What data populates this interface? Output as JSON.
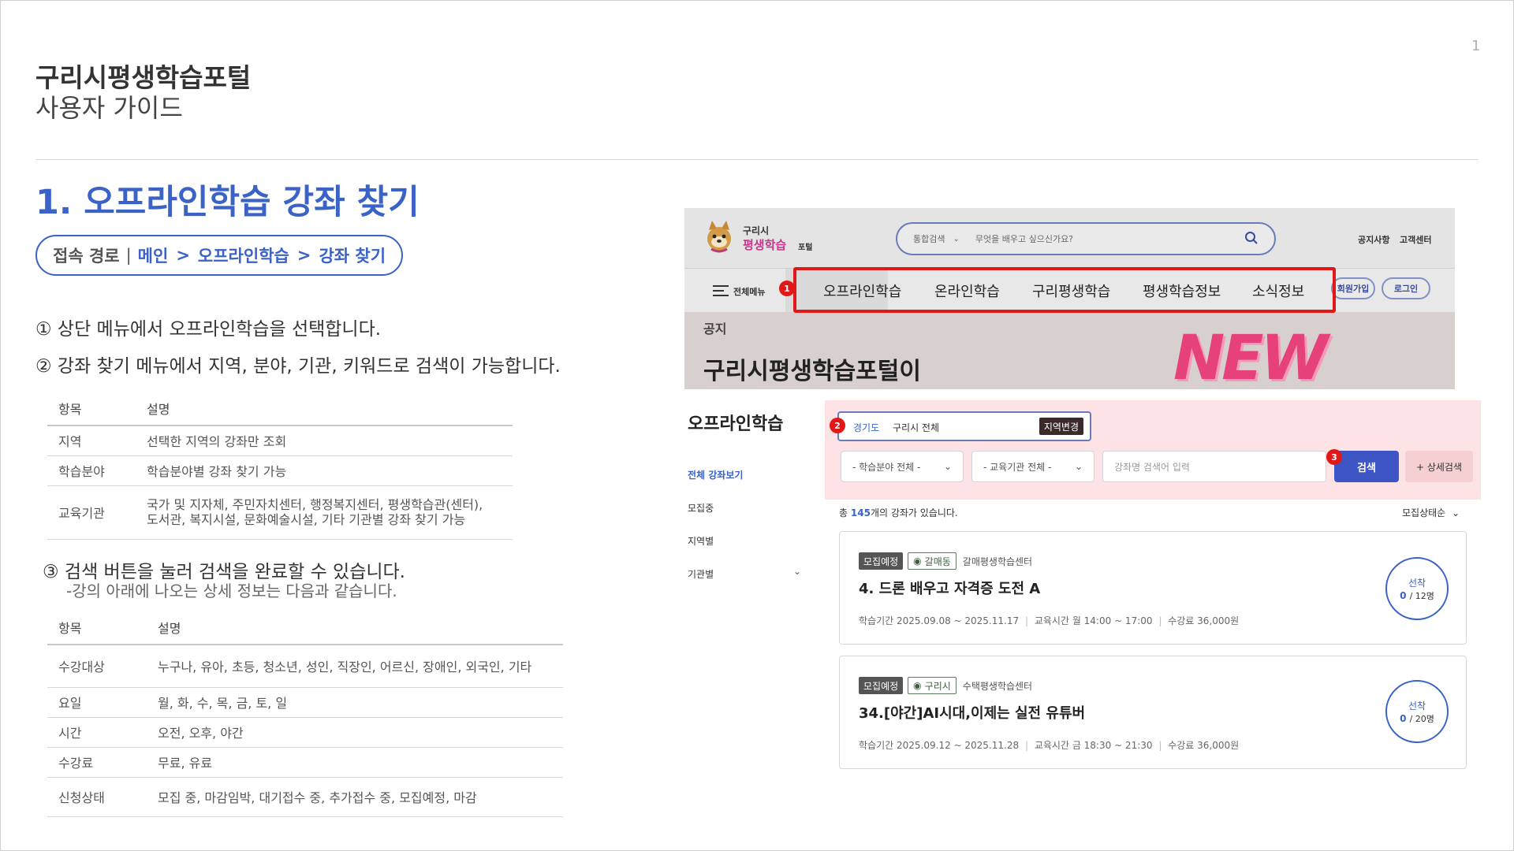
{
  "header": {
    "title": "구리시평생학습포털",
    "subtitle": "사용자 가이드",
    "page_number": "1"
  },
  "section": {
    "title": "1. 오프라인학습 강좌 찾기",
    "path_label": "접속 경로",
    "path_separator": "|",
    "path": [
      "메인",
      "오프라인학습",
      "강좌 찾기"
    ],
    "path_arrow": ">"
  },
  "steps": {
    "step1": "① 상단 메뉴에서 오프라인학습을 선택합니다.",
    "step2": "② 강좌 찾기 메뉴에서 지역, 분야, 기관, 키워드로 검색이 가능합니다.",
    "step3": "③ 검색 버튼을 눌러 검색을 완료할 수 있습니다.",
    "step3_sub": "-강의 아래에 나오는 상세 정보는 다음과 같습니다."
  },
  "table1": {
    "headers": [
      "항목",
      "설명"
    ],
    "rows": [
      [
        "지역",
        "선택한 지역의 강좌만 조회"
      ],
      [
        "학습분야",
        "학습분야별 강좌 찾기 가능"
      ],
      [
        "교육기관",
        "국가 및 지자체, 주민자치센터, 행정복지센터, 평생학습관(센터),\n도서관, 복지시설, 문화예술시설, 기타 기관별 강좌 찾기 가능"
      ]
    ]
  },
  "table2": {
    "headers": [
      "항목",
      "설명"
    ],
    "rows": [
      [
        "수강대상",
        "누구나, 유아, 초등, 청소년, 성인, 직장인, 어르신, 장애인, 외국인, 기타"
      ],
      [
        "요일",
        "월, 화, 수, 목, 금, 토, 일"
      ],
      [
        "시간",
        "오전, 오후, 야간"
      ],
      [
        "수강료",
        "무료, 유료"
      ],
      [
        "신청상태",
        "모집 중, 마감임박, 대기접수 중, 추가접수 중, 모집예정, 마감"
      ]
    ]
  },
  "screenshot": {
    "logo_top": "구리시",
    "logo_bottom": "평생학습",
    "logo_suffix": "포털",
    "search_category": "통합검색",
    "search_placeholder": "무엇을 배우고 싶으신가요?",
    "util_links": [
      "공지사항",
      "고객센터"
    ],
    "all_menu": "전체메뉴",
    "nav_items": [
      "오프라인학습",
      "온라인학습",
      "구리평생학습",
      "평생학습정보",
      "소식정보"
    ],
    "auth_buttons": [
      "회원가입",
      "로그인"
    ],
    "hero_label": "공지",
    "hero_title": "구리시평생학습포털이",
    "hero_art": "NEW",
    "badges": [
      "1",
      "2",
      "3"
    ],
    "sidebar_title": "오프라인학습",
    "sidebar_items": [
      "전체 강좌보기",
      "모집중",
      "지역별",
      "기관별"
    ],
    "region_province": "경기도",
    "region_city": "구리시 전체",
    "region_change": "지역변경",
    "field_select": "- 학습분야 전체 -",
    "org_select": "- 교육기관 전체 -",
    "keyword_placeholder": "강좌명 검색어 입력",
    "search_button": "검색",
    "detail_search": "+ 상세검색",
    "result_prefix": "총",
    "result_count": "145",
    "result_suffix": "개의 강좌가 있습니다.",
    "sort_label": "모집상태순",
    "courses": [
      {
        "status": "모집예정",
        "location": "갈매동",
        "org": "갈매평생학습센터",
        "title": "4. 드론 배우고 자격증 도전 A",
        "period_label": "학습기간",
        "period": "2025.09.08 ~ 2025.11.17",
        "time_label": "교육시간",
        "time": "월 14:00 ~ 17:00",
        "fee_label": "수강료",
        "fee": "36,000원",
        "method": "선착",
        "enrolled": "0",
        "capacity": "/ 12명"
      },
      {
        "status": "모집예정",
        "location": "구리시",
        "org": "수택평생학습센터",
        "title": "34.[야간]AI시대,이제는 실전 유튜버",
        "period_label": "학습기간",
        "period": "2025.09.12 ~ 2025.11.28",
        "time_label": "교육시간",
        "time": "금 18:30 ~ 21:30",
        "fee_label": "수강료",
        "fee": "36,000원",
        "method": "선착",
        "enrolled": "0",
        "capacity": "/ 20명"
      }
    ]
  },
  "colors": {
    "accent": "#3a62c7",
    "highlight_red": "#e01818",
    "filter_bg": "#fde3e5"
  }
}
